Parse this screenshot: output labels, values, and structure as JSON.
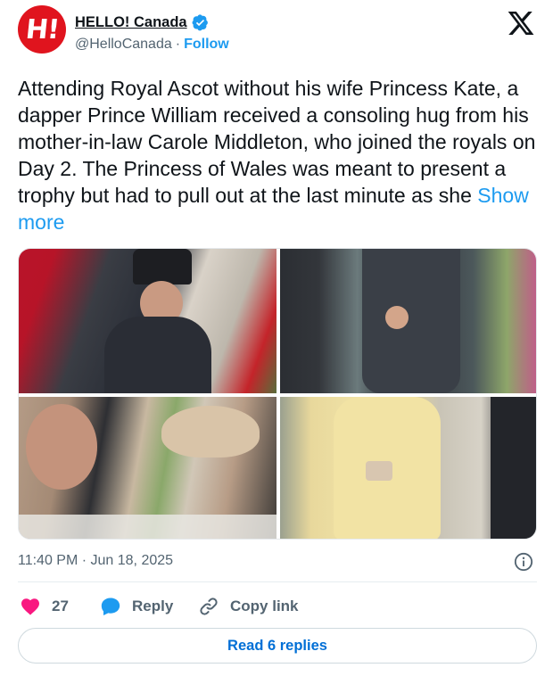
{
  "account": {
    "display_name": "HELLO! Canada",
    "handle": "@HelloCanada",
    "separator": "·",
    "follow_label": "Follow",
    "avatar_text": "H!",
    "verified_icon": "verified-badge-icon",
    "brand_color": "#e0141e"
  },
  "platform": {
    "logo": "x-logo-icon"
  },
  "tweet": {
    "text": "Attending Royal Ascot without his wife Princess Kate, a dapper Prince William received a consoling hug from his mother-in-law Carole Middleton, who joined the royals on Day 2. The Princess of Wales was meant to present a trophy but had to pull out at the last minute as she ",
    "show_more_label": "Show more",
    "timestamp": "11:40 PM · Jun 18, 2025"
  },
  "media": {
    "photos": [
      "photo-1",
      "photo-2",
      "photo-3",
      "photo-4"
    ]
  },
  "actions": {
    "likes_count": "27",
    "reply_label": "Reply",
    "copy_link_label": "Copy link"
  },
  "read_replies_label": "Read 6 replies",
  "colors": {
    "accent": "#1d9bf0",
    "like": "#f91880",
    "muted": "#536471",
    "text": "#0f1419"
  }
}
